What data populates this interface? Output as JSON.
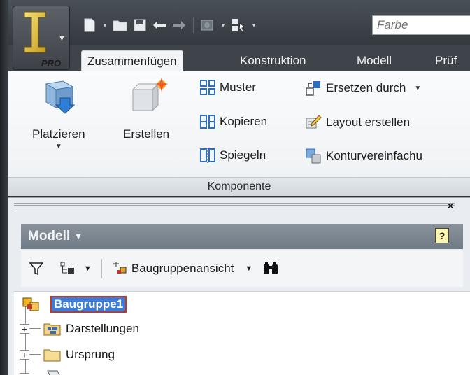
{
  "app": {
    "badge": "PRO"
  },
  "qat": {
    "icons": [
      "new-icon",
      "open-icon",
      "save-icon",
      "undo-icon",
      "redo-icon",
      "material-icon",
      "appearance-icon"
    ],
    "color_field_placeholder": "Farbe"
  },
  "tabs": [
    {
      "label": "Zusammenfügen",
      "active": true
    },
    {
      "label": "Konstruktion"
    },
    {
      "label": "Modell"
    },
    {
      "label": "Prüf"
    }
  ],
  "ribbon": {
    "place": "Platzieren",
    "create": "Erstellen",
    "pattern": "Muster",
    "copy": "Kopieren",
    "mirror": "Spiegeln",
    "replace": "Ersetzen durch",
    "layout": "Layout erstellen",
    "simplify": "Konturvereinfachu",
    "panel_title": "Komponente"
  },
  "browser": {
    "title": "Modell",
    "help": "?",
    "view_mode": "Baugruppenansicht",
    "tree": [
      {
        "label": "Baugruppe1",
        "selected": true
      },
      {
        "label": "Darstellungen"
      },
      {
        "label": "Ursprung"
      }
    ]
  },
  "colors": {
    "accent": "#3b7ddb",
    "tab_bar": "#3e444a",
    "panel_header": "#7c868f"
  }
}
